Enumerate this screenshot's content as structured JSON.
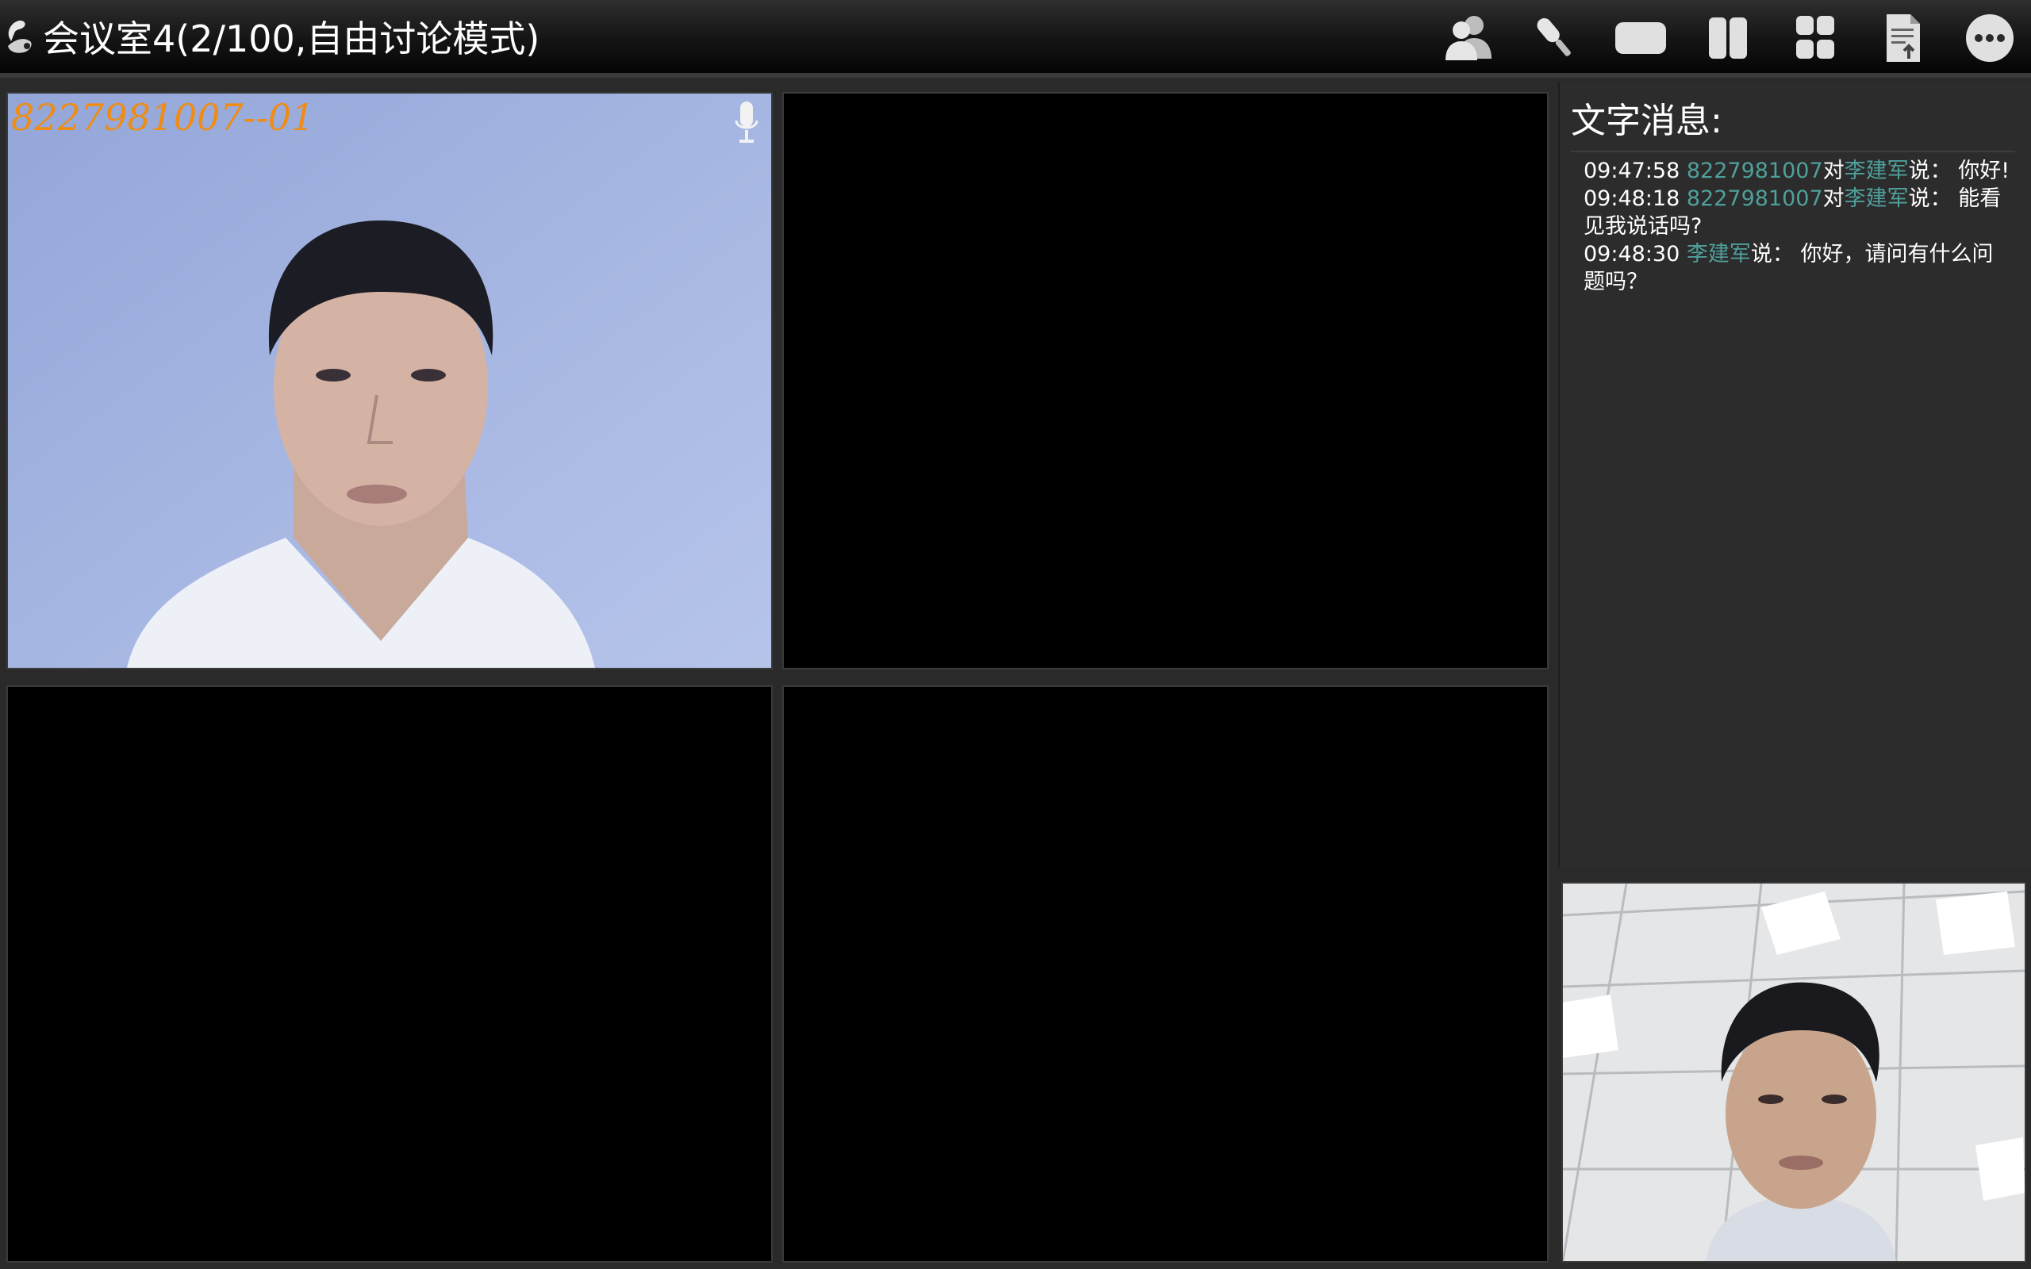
{
  "title_bar": {
    "room_title": "会议室4(2/100,自由讨论模式)"
  },
  "toolbar": {
    "buttons": [
      {
        "icon": "participants-icon"
      },
      {
        "icon": "microphone-icon"
      },
      {
        "icon": "single-view-icon"
      },
      {
        "icon": "two-view-icon"
      },
      {
        "icon": "four-view-icon"
      },
      {
        "icon": "document-share-icon"
      },
      {
        "icon": "more-options-icon"
      }
    ]
  },
  "video_grid": {
    "cells": [
      {
        "label": "8227981007--01",
        "has_video": true,
        "mic_icon": "microphone-icon"
      },
      {
        "label": "",
        "has_video": false
      },
      {
        "label": "",
        "has_video": false
      },
      {
        "label": "",
        "has_video": false
      }
    ]
  },
  "chat": {
    "title": "文字消息:",
    "messages": [
      {
        "time": "09:47:58",
        "from": "8227981007",
        "to_word": "对",
        "to": "李建军",
        "say": "说：",
        "text": "你好!"
      },
      {
        "time": "09:48:18",
        "from": "8227981007",
        "to_word": "对",
        "to": "李建军",
        "say": "说：",
        "text": "能看见我说话吗?"
      },
      {
        "time": "09:48:30",
        "from": "李建军",
        "to_word": "",
        "to": "",
        "say": "说：",
        "text": "你好，请问有什么问题吗？"
      }
    ]
  },
  "colors": {
    "label_orange": "#f08c14",
    "name_teal": "#4fa09b",
    "video_bg": "#000000"
  }
}
